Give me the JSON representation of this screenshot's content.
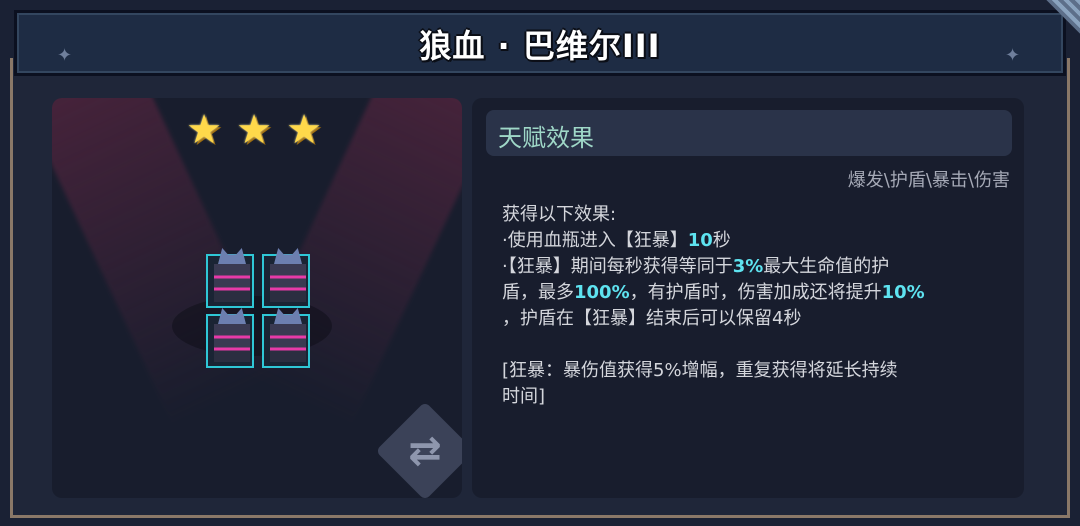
{
  "title": "狼血 · 巴维尔III",
  "colors": {
    "highlight": "#5ee3f0",
    "star": "#ffd84a",
    "frame_border": "#2fc7d6"
  },
  "stars": {
    "filled": 3,
    "total": 3
  },
  "talent": {
    "header": "天赋效果",
    "tags": "爆发\\护盾\\暴击\\伤害",
    "lines": [
      [
        {
          "t": "获得以下效果:"
        }
      ],
      [
        {
          "t": "·使用血瓶进入【狂暴】"
        },
        {
          "t": "10",
          "hl": true
        },
        {
          "t": "秒"
        }
      ],
      [
        {
          "t": "·【狂暴】期间每秒获得等同于"
        },
        {
          "t": "3%",
          "hl": true
        },
        {
          "t": "最大生命值的护"
        }
      ],
      [
        {
          "t": "盾，最多"
        },
        {
          "t": "100%",
          "hl": true
        },
        {
          "t": "，有护盾时，伤害加成还将提升"
        },
        {
          "t": "10%",
          "hl": true
        }
      ],
      [
        {
          "t": "，护盾在【狂暴】结束后可以保留4秒"
        }
      ],
      [
        {
          "t": ""
        }
      ],
      [
        {
          "t": "[狂暴：暴伤值获得5%增幅，重复获得将延长持续"
        }
      ],
      [
        {
          "t": "时间]"
        }
      ]
    ]
  },
  "icons": {
    "swap": "swap-icon",
    "star": "star-icon"
  },
  "units": [
    "werewolf-unit",
    "werewolf-unit",
    "werewolf-unit",
    "werewolf-unit"
  ]
}
